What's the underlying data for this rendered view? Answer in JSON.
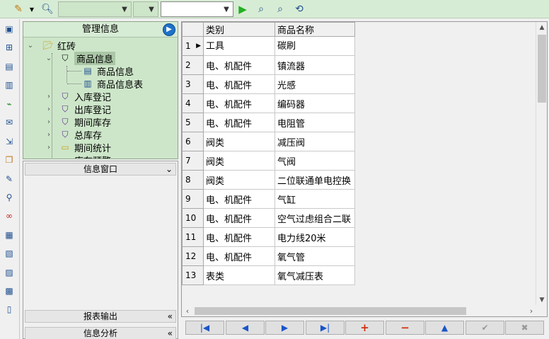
{
  "toolbar": {
    "edit_icon": "pencil-icon",
    "dropdown_icon": "dropdown-arrow-icon",
    "search_icon": "magnifier-icon",
    "combo1_value": "",
    "combo2_value": "",
    "combo3_value": "",
    "run_icon": "play-icon",
    "find_icon": "find-icon",
    "find_next_icon": "find-next-icon",
    "refresh_icon": "refresh-icon",
    "run_color": "#22b022"
  },
  "tree": {
    "title": "管理信息",
    "root": "红砖",
    "nodes": [
      {
        "label": "商品信息",
        "icon": "tag-icon"
      },
      {
        "label": "商品信息",
        "icon": "form-icon"
      },
      {
        "label": "商品信息表",
        "icon": "document-icon"
      },
      {
        "label": "入库登记",
        "icon": "tag-icon"
      },
      {
        "label": "出库登记",
        "icon": "tag-icon"
      },
      {
        "label": "期间库存",
        "icon": "tag-icon"
      },
      {
        "label": "总库存",
        "icon": "tag-icon"
      },
      {
        "label": "期间统计",
        "icon": "folder-icon"
      },
      {
        "label": "库存预警",
        "icon": "folder-icon"
      }
    ]
  },
  "info_panel": {
    "title": "信息窗口",
    "report_output": "报表输出",
    "info_analysis": "信息分析"
  },
  "grid": {
    "columns": [
      "类别",
      "商品名称"
    ],
    "rows": [
      {
        "num": "1",
        "category": "工具",
        "name": "碳刷"
      },
      {
        "num": "2",
        "category": "电、机配件",
        "name": "镇流器"
      },
      {
        "num": "3",
        "category": "电、机配件",
        "name": "光感"
      },
      {
        "num": "4",
        "category": "电、机配件",
        "name": "编码器"
      },
      {
        "num": "5",
        "category": "电、机配件",
        "name": "电阻管"
      },
      {
        "num": "6",
        "category": "阀类",
        "name": "减压阀"
      },
      {
        "num": "7",
        "category": "阀类",
        "name": "气阀"
      },
      {
        "num": "8",
        "category": "阀类",
        "name": "二位联通单电控换"
      },
      {
        "num": "9",
        "category": "电、机配件",
        "name": "气缸"
      },
      {
        "num": "10",
        "category": "电、机配件",
        "name": "空气过虑组合二联"
      },
      {
        "num": "11",
        "category": "电、机配件",
        "name": "电力线20米"
      },
      {
        "num": "12",
        "category": "电、机配件",
        "name": "氧气管"
      },
      {
        "num": "13",
        "category": "表类",
        "name": "氧气减压表"
      }
    ]
  },
  "navbar": {
    "first": "|◀",
    "prev": "◀",
    "next": "▶",
    "last": "▶|",
    "add": "+",
    "delete": "−",
    "up": "▲",
    "confirm": "✔",
    "cancel": "✖",
    "nav_color": "#1a55c8",
    "add_color": "#d03010"
  }
}
